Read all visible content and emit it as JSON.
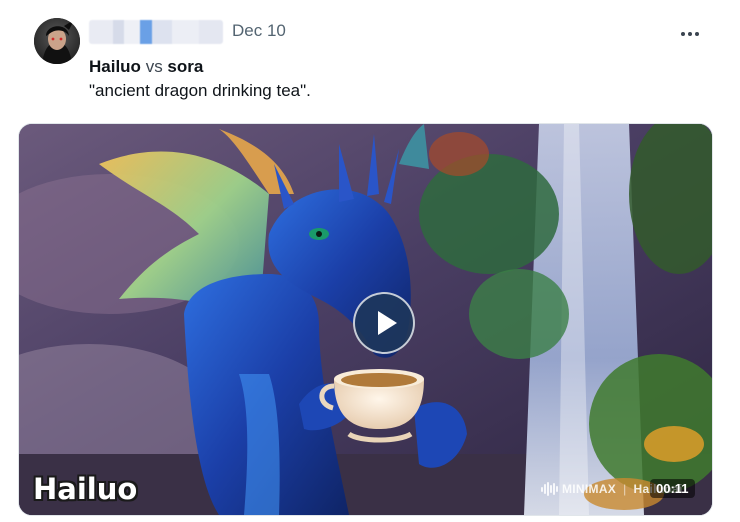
{
  "tweet": {
    "date": "Dec 10",
    "headline": {
      "left": "Hailuo",
      "middle": "vs",
      "right": "sora"
    },
    "caption": "\"ancient dragon drinking tea\"."
  },
  "media": {
    "watermark": "Hailuo",
    "brand_left": "MINIMAX",
    "brand_sep": "|",
    "brand_right": "Hailuoai",
    "duration": "00:11"
  },
  "icons": {
    "more": "more-horizontal-icon",
    "play": "play-icon",
    "brand": "soundwave-icon"
  }
}
